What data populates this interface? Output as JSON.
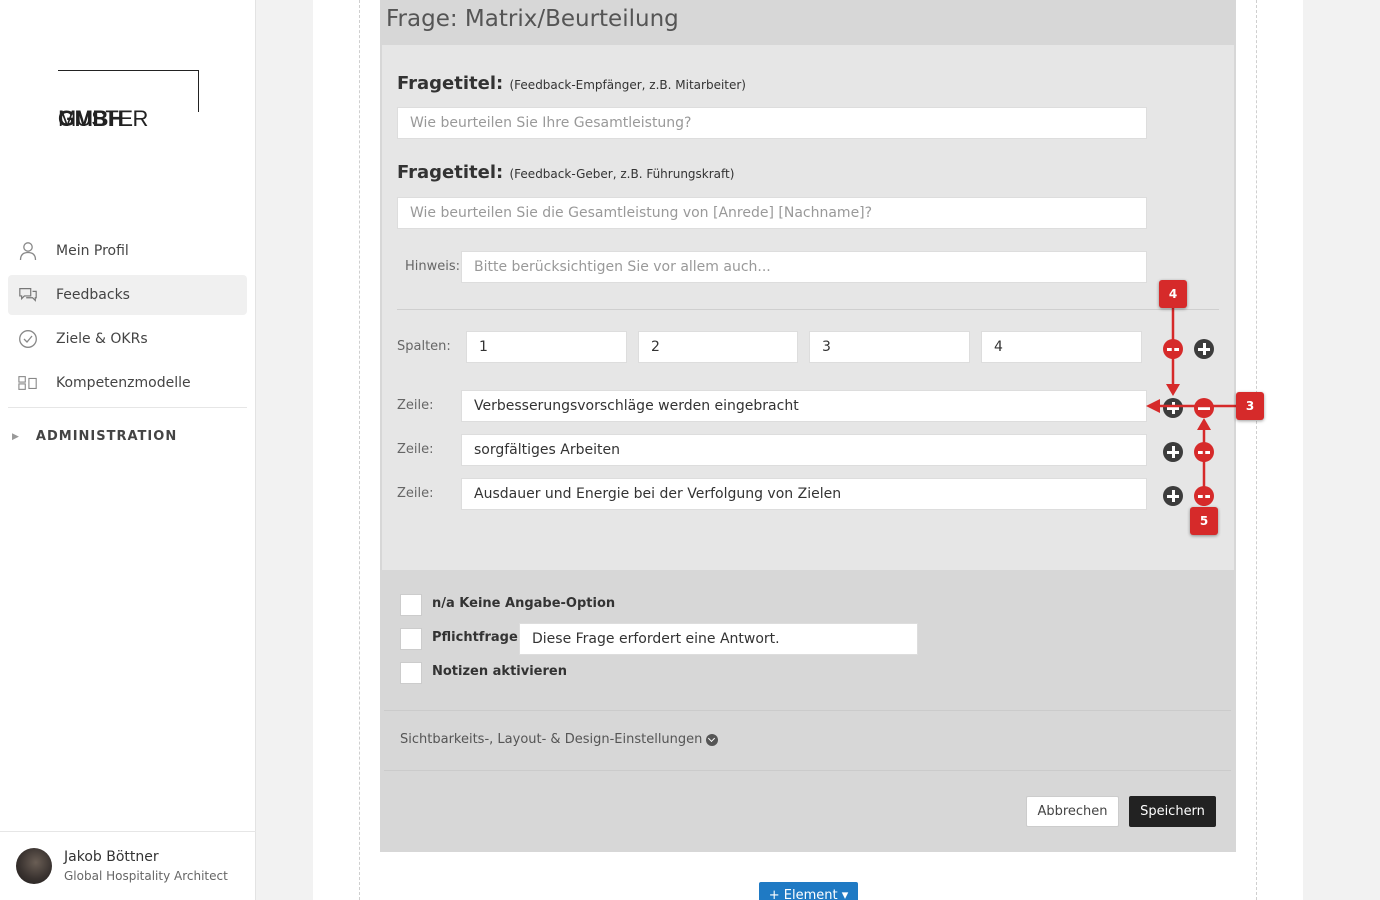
{
  "sidebar": {
    "logo_thin": "MUSTER",
    "logo_bold": "GMBH",
    "items": [
      {
        "label": "Mein Profil",
        "icon": "person-icon"
      },
      {
        "label": "Feedbacks",
        "icon": "chat-bubbles-icon"
      },
      {
        "label": "Ziele & OKRs",
        "icon": "check-circle-icon"
      },
      {
        "label": "Kompetenzmodelle",
        "icon": "grid-icon"
      }
    ],
    "active_index": 1,
    "admin_label": "ADMINISTRATION",
    "user": {
      "name": "Jakob Böttner",
      "role": "Global Hospitality Architect"
    }
  },
  "question": {
    "header": "Frage: Matrix/Beurteilung",
    "title1_label": "Fragetitel:",
    "title1_note": "(Feedback-Empfänger, z.B. Mitarbeiter)",
    "title1_placeholder": "Wie beurteilen Sie Ihre Gesamtleistung?",
    "title2_label": "Fragetitel:",
    "title2_note": "(Feedback-Geber, z.B. Führungskraft)",
    "title2_placeholder": "Wie beurteilen Sie die Gesamtleistung von [Anrede] [Nachname]?",
    "hint_label": "Hinweis:",
    "hint_placeholder": "Bitte berücksichtigen Sie vor allem auch...",
    "columns_label": "Spalten:",
    "columns": [
      "1",
      "2",
      "3",
      "4"
    ],
    "row_label": "Zeile:",
    "rows": [
      "Verbesserungsvorschläge werden eingebracht",
      "sorgfältiges Arbeiten",
      "Ausdauer und Energie bei der Verfolgung von Zielen"
    ]
  },
  "options": {
    "na_label": "n/a Keine Angabe-Option",
    "required_label": "Pflichtfrage",
    "required_text": "Diese Frage erfordert eine Antwort.",
    "notes_label": "Notizen aktivieren",
    "visibility_label": "Sichtbarkeits-, Layout- & Design-Einstellungen"
  },
  "buttons": {
    "cancel": "Abbrechen",
    "save": "Speichern",
    "add_element": "+ Element ▾"
  },
  "annotations": [
    "4",
    "3",
    "5"
  ],
  "colors": {
    "accent_red": "#d62a2a",
    "primary_blue": "#1f7ac4",
    "save_dark": "#222222"
  }
}
